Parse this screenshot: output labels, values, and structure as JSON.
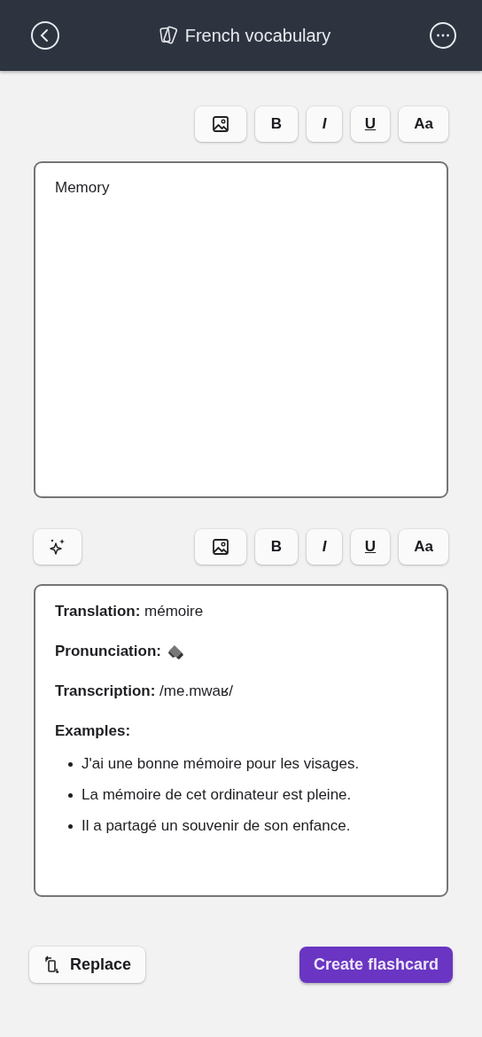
{
  "header": {
    "title": "French vocabulary"
  },
  "front_toolbar": {
    "buttons": [
      {
        "kind": "image"
      },
      {
        "kind": "bold",
        "label": "B"
      },
      {
        "kind": "italic",
        "label": "I"
      },
      {
        "kind": "underline",
        "label": "U"
      },
      {
        "kind": "size",
        "label": "Aa"
      }
    ]
  },
  "front": {
    "value": "Memory"
  },
  "back_toolbar": {
    "buttons": [
      {
        "kind": "image"
      },
      {
        "kind": "bold",
        "label": "B"
      },
      {
        "kind": "italic",
        "label": "I"
      },
      {
        "kind": "underline",
        "label": "U"
      },
      {
        "kind": "size",
        "label": "Aa"
      }
    ]
  },
  "back": {
    "lines": [
      {
        "kind": "text",
        "text": "**Translation:** mémoire"
      },
      {
        "kind": "audio",
        "text": "Pronunciation:"
      },
      {
        "kind": "text",
        "text": "**Transcription:** /me.mwaʁ/"
      },
      {
        "kind": "heading",
        "text": "Examples:"
      },
      {
        "kind": "list",
        "items": [
          "J'ai une bonne mémoire pour les visages.",
          "La mémoire de cet ordinateur est pleine.",
          "Il a partagé un souvenir de son enfance."
        ]
      }
    ]
  },
  "actions": {
    "replace": "Replace",
    "create": "Create flashcard"
  }
}
